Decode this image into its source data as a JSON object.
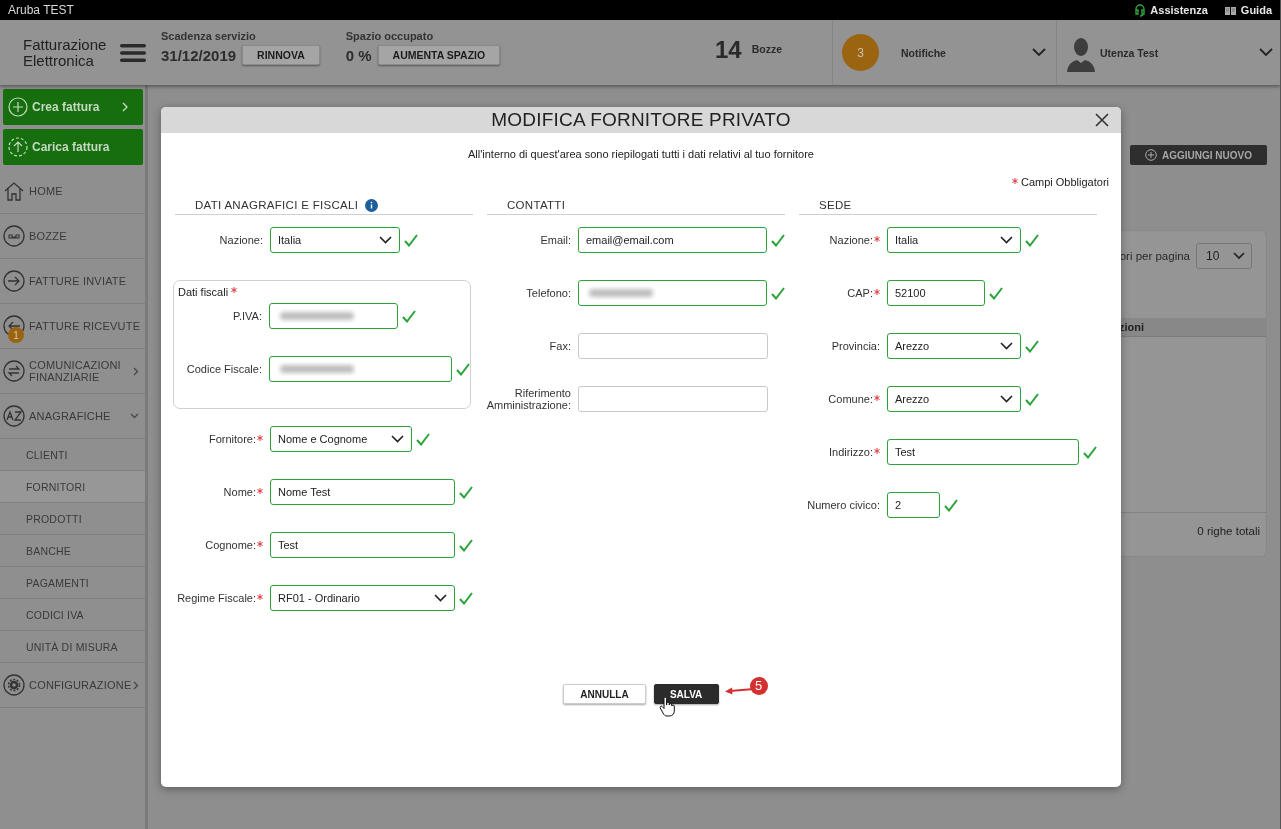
{
  "top_bar": {
    "title": "Aruba TEST",
    "links": [
      {
        "label": "Assistenza"
      },
      {
        "label": "Guida"
      }
    ]
  },
  "header": {
    "logo": "Fatturazione Elettronica",
    "service": {
      "label": "Scadenza servizio",
      "value": "31/12/2019",
      "button": "RINNOVA"
    },
    "storage": {
      "label": "Spazio occupato",
      "value": "0 %",
      "button": "AUMENTA SPAZIO"
    },
    "drafts": {
      "count": "14",
      "label": "Bozze"
    },
    "notifications": {
      "count": "3",
      "label": "Notifiche"
    },
    "user": {
      "name": "Utenza Test"
    }
  },
  "sidebar": {
    "actions": [
      {
        "label": "Crea fattura"
      },
      {
        "label": "Carica fattura"
      }
    ],
    "items": [
      {
        "label": "HOME"
      },
      {
        "label": "BOZZE"
      },
      {
        "label": "FATTURE INVIATE"
      },
      {
        "label": "FATTURE RICEVUTE",
        "badge": "1"
      },
      {
        "label": "COMUNICAZIONI FINANZIARIE",
        "expanded": false
      },
      {
        "label": "ANAGRAFICHE",
        "expanded": true,
        "children": [
          {
            "label": "CLIENTI",
            "selected": false
          },
          {
            "label": "FORNITORI",
            "selected": true
          },
          {
            "label": "PRODOTTI",
            "selected": false
          },
          {
            "label": "BANCHE",
            "selected": false
          },
          {
            "label": "PAGAMENTI",
            "selected": false
          },
          {
            "label": "CODICI IVA",
            "selected": false
          },
          {
            "label": "UNITÀ DI MISURA",
            "selected": false
          }
        ]
      },
      {
        "label": "CONFIGURAZIONE",
        "expanded": false
      }
    ]
  },
  "page": {
    "add_button": "AGGIUNGI NUOVO",
    "per_page_label": "ori per pagina",
    "per_page": "10",
    "column_header": "zioni",
    "total": "0 righe totali"
  },
  "modal": {
    "title": "MODIFICA FORNITORE PRIVATO",
    "intro": "All'interno di quest'area sono riepilogati tutti i dati relativi al tuo fornitore",
    "required_note": "Campi Obbligatori",
    "sections": [
      {
        "heading": "DATI ANAGRAFICI E FISCALI",
        "info": true,
        "fields": [
          {
            "kind": "select",
            "label": "Nazione:",
            "required": false,
            "value": "Italia",
            "valid": true
          },
          {
            "kind": "group",
            "label": "Dati fiscali",
            "required": true,
            "fields": [
              {
                "kind": "blurred",
                "label": "P.IVA:",
                "required": false,
                "valid": true
              },
              {
                "kind": "blurred",
                "label": "Codice Fiscale:",
                "required": false,
                "valid": true
              }
            ]
          },
          {
            "kind": "select",
            "label": "Fornitore:",
            "required": true,
            "value": "Nome e Cognome",
            "valid": true
          },
          {
            "kind": "text",
            "label": "Nome:",
            "required": true,
            "value": "Nome Test",
            "valid": true
          },
          {
            "kind": "text",
            "label": "Cognome:",
            "required": true,
            "value": "Test",
            "valid": true
          },
          {
            "kind": "select",
            "label": "Regime Fiscale:",
            "required": true,
            "value": "RF01 - Ordinario",
            "valid": true
          }
        ]
      },
      {
        "heading": "CONTATTI",
        "info": false,
        "fields": [
          {
            "kind": "text",
            "label": "Email:",
            "required": false,
            "value": "email@email.com",
            "valid": true
          },
          {
            "kind": "blurred",
            "label": "Telefono:",
            "required": false,
            "valid": true
          },
          {
            "kind": "text",
            "label": "Fax:",
            "required": false,
            "valid": false
          },
          {
            "kind": "text",
            "label": "Riferimento Amministrazione:",
            "required": false,
            "valid": false
          }
        ]
      },
      {
        "heading": "SEDE",
        "info": false,
        "fields": [
          {
            "kind": "select",
            "label": "Nazione:",
            "required": true,
            "value": "Italia",
            "valid": true
          },
          {
            "kind": "text",
            "label": "CAP:",
            "required": true,
            "value": "52100",
            "valid": true
          },
          {
            "kind": "select",
            "label": "Provincia:",
            "required": false,
            "value": "Arezzo",
            "valid": true
          },
          {
            "kind": "select",
            "label": "Comune:",
            "required": true,
            "value": "Arezzo",
            "valid": true
          },
          {
            "kind": "text",
            "label": "Indirizzo:",
            "required": true,
            "value": "Test",
            "valid": true
          },
          {
            "kind": "text",
            "label": "Numero civico:",
            "required": false,
            "value": "2",
            "valid": true
          }
        ]
      }
    ],
    "buttons": [
      {
        "label": "ANNULLA",
        "kind": "secondary"
      },
      {
        "label": "SALVA",
        "kind": "primary"
      }
    ],
    "annotation": {
      "label": "5"
    }
  }
}
